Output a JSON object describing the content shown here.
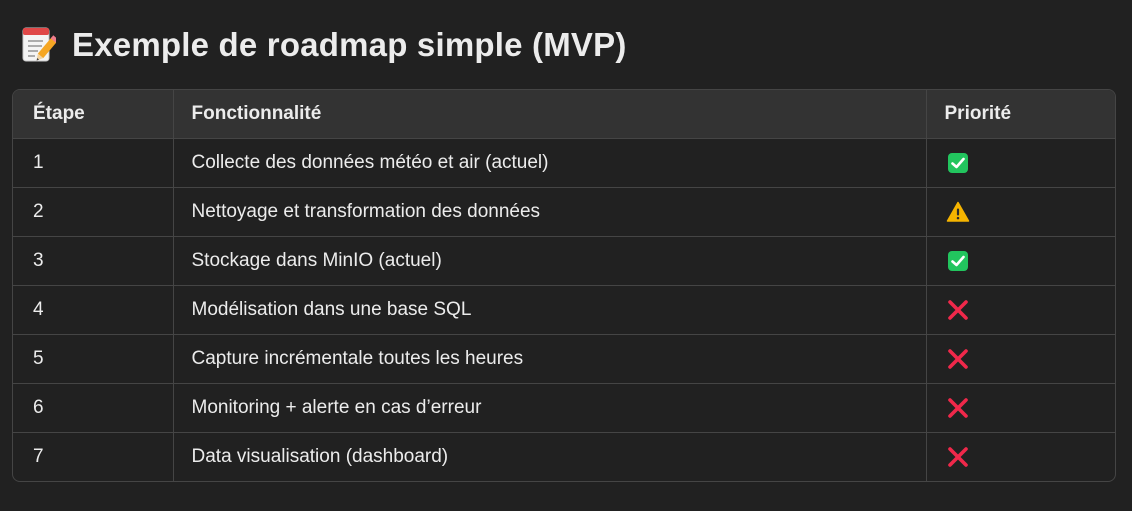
{
  "page": {
    "title": "Exemple de roadmap simple (MVP)",
    "title_icon": "memo-icon"
  },
  "table": {
    "headers": {
      "step": "Étape",
      "feature": "Fonctionnalité",
      "priority": "Priorité"
    },
    "rows": [
      {
        "step": "1",
        "feature": "Collecte des données météo et air (actuel)",
        "priority": "check-mark-button-icon"
      },
      {
        "step": "2",
        "feature": "Nettoyage et transformation des données",
        "priority": "warning-icon"
      },
      {
        "step": "3",
        "feature": "Stockage dans MinIO (actuel)",
        "priority": "check-mark-button-icon"
      },
      {
        "step": "4",
        "feature": "Modélisation dans une base SQL",
        "priority": "cross-mark-icon"
      },
      {
        "step": "5",
        "feature": "Capture incrémentale toutes les heures",
        "priority": "cross-mark-icon"
      },
      {
        "step": "6",
        "feature": "Monitoring + alerte en cas d’erreur",
        "priority": "cross-mark-icon"
      },
      {
        "step": "7",
        "feature": "Data visualisation (dashboard)",
        "priority": "cross-mark-icon"
      }
    ]
  },
  "colors": {
    "background": "#212121",
    "header_bg": "#333333",
    "border": "#454545",
    "check": "#22c55e",
    "warning": "#f5b400",
    "cross": "#f0284a"
  }
}
